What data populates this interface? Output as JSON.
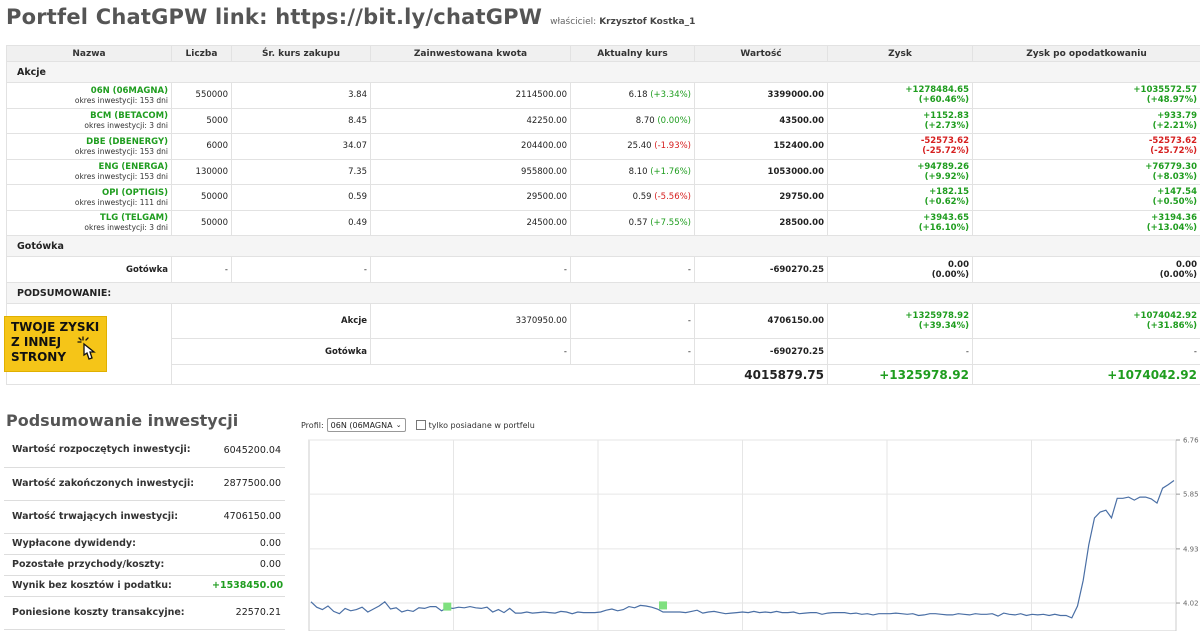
{
  "header": {
    "title": "Portfel ChatGPW link: https://bit.ly/chatGPW",
    "owner_label": "właściciel:",
    "owner_name": "Krzysztof Kostka_1"
  },
  "table": {
    "columns": [
      "Nazwa",
      "Liczba",
      "Śr. kurs zakupu",
      "Zainwestowana kwota",
      "Aktualny kurs",
      "Wartość",
      "Zysk",
      "Zysk po opodatkowaniu"
    ],
    "section_stocks": "Akcje",
    "stocks": [
      {
        "ticker": "06N (06MAGNA)",
        "period": "okres inwestycji: 153 dni",
        "count": "550000",
        "avg": "3.84",
        "invested": "2114500.00",
        "price": "6.18",
        "change": "(+3.34%)",
        "change_sign": "pos",
        "value": "3399000.00",
        "profit": "+1278484.65",
        "profit_pct": "(+60.46%)",
        "profit_sign": "pos",
        "net": "+1035572.57",
        "net_pct": "(+48.97%)"
      },
      {
        "ticker": "BCM (BETACOM)",
        "period": "okres inwestycji: 3 dni",
        "count": "5000",
        "avg": "8.45",
        "invested": "42250.00",
        "price": "8.70",
        "change": "(0.00%)",
        "change_sign": "pos",
        "value": "43500.00",
        "profit": "+1152.83",
        "profit_pct": "(+2.73%)",
        "profit_sign": "pos",
        "net": "+933.79",
        "net_pct": "(+2.21%)"
      },
      {
        "ticker": "DBE (DBENERGY)",
        "period": "okres inwestycji: 153 dni",
        "count": "6000",
        "avg": "34.07",
        "invested": "204400.00",
        "price": "25.40",
        "change": "(-1.93%)",
        "change_sign": "neg",
        "value": "152400.00",
        "profit": "-52573.62",
        "profit_pct": "(-25.72%)",
        "profit_sign": "neg",
        "net": "-52573.62",
        "net_pct": "(-25.72%)"
      },
      {
        "ticker": "ENG (ENERGA)",
        "period": "okres inwestycji: 153 dni",
        "count": "130000",
        "avg": "7.35",
        "invested": "955800.00",
        "price": "8.10",
        "change": "(+1.76%)",
        "change_sign": "pos",
        "value": "1053000.00",
        "profit": "+94789.26",
        "profit_pct": "(+9.92%)",
        "profit_sign": "pos",
        "net": "+76779.30",
        "net_pct": "(+8.03%)"
      },
      {
        "ticker": "OPI (OPTIGIS)",
        "period": "okres inwestycji: 111 dni",
        "count": "50000",
        "avg": "0.59",
        "invested": "29500.00",
        "price": "0.59",
        "change": "(-5.56%)",
        "change_sign": "neg",
        "value": "29750.00",
        "profit": "+182.15",
        "profit_pct": "(+0.62%)",
        "profit_sign": "pos",
        "net": "+147.54",
        "net_pct": "(+0.50%)"
      },
      {
        "ticker": "TLG (TELGAM)",
        "period": "okres inwestycji: 3 dni",
        "count": "50000",
        "avg": "0.49",
        "invested": "24500.00",
        "price": "0.57",
        "change": "(+7.55%)",
        "change_sign": "pos",
        "value": "28500.00",
        "profit": "+3943.65",
        "profit_pct": "(+16.10%)",
        "profit_sign": "pos",
        "net": "+3194.36",
        "net_pct": "(+13.04%)"
      }
    ],
    "section_cash": "Gotówka",
    "cash": {
      "name": "Gotówka",
      "count": "-",
      "avg": "-",
      "invested": "-",
      "price": "-",
      "value": "-690270.25",
      "profit": "0.00",
      "profit_pct": "(0.00%)",
      "net": "0.00",
      "net_pct": "(0.00%)"
    },
    "section_summary": "PODSUMOWANIE:",
    "summary_stocks": {
      "label": "Akcje",
      "invested": "3370950.00",
      "price": "-",
      "value": "4706150.00",
      "profit": "+1325978.92",
      "profit_pct": "(+39.34%)",
      "net": "+1074042.92",
      "net_pct": "(+31.86%)"
    },
    "summary_cash": {
      "label": "Gotówka",
      "invested": "-",
      "price": "-",
      "value": "-690270.25",
      "profit": "-",
      "net": "-"
    },
    "totals": {
      "value": "4015879.75",
      "profit": "+1325978.92",
      "net": "+1074042.92"
    }
  },
  "promo": {
    "line1": "TWOJE ZYSKI",
    "line2": "Z INNEJ",
    "line3": "STRONY",
    "icon": "pointer-hand-icon",
    "bg": "#f5c518"
  },
  "investments": {
    "title": "Podsumowanie inwestycji",
    "rows": [
      {
        "label": "Wartość rozpoczętych inwestycji:",
        "value": "6045200.04"
      },
      {
        "label": "Wartość zakończonych inwestycji:",
        "value": "2877500.00"
      },
      {
        "label": "Wartość trwających inwestycji:",
        "value": "4706150.00"
      },
      {
        "label": "Wypłacone dywidendy:",
        "value": "0.00"
      },
      {
        "label": "Pozostałe przychody/koszty:",
        "value": "0.00"
      },
      {
        "label": "Wynik bez kosztów i podatku:",
        "value": "+1538450.00"
      },
      {
        "label": "Poniesione koszty transakcyjne:",
        "value": "22570.21"
      }
    ]
  },
  "chart_controls": {
    "profile_label": "Profil:",
    "profile_value": "06N (06MAGNA",
    "checkbox_label": "tylko posiadane w portfelu",
    "checkbox_checked": false
  },
  "chart_data": {
    "type": "line",
    "title": "",
    "xlabel": "",
    "ylabel": "",
    "y_ticks": [
      4.02,
      4.93,
      5.85,
      6.76
    ],
    "ylim": [
      3.55,
      6.76
    ],
    "grid": true,
    "series": [
      {
        "color": "#4a6fa5",
        "values": [
          4.04,
          3.95,
          3.91,
          3.97,
          3.88,
          3.84,
          3.93,
          3.89,
          3.91,
          3.95,
          3.87,
          3.92,
          3.97,
          4.04,
          3.92,
          3.94,
          3.87,
          3.9,
          3.88,
          3.94,
          3.93,
          3.96,
          3.96,
          3.89,
          3.94,
          3.93,
          3.95,
          3.94,
          3.96,
          3.94,
          3.93,
          3.95,
          3.87,
          3.91,
          3.86,
          3.93,
          3.85,
          3.85,
          3.87,
          3.85,
          3.86,
          3.87,
          3.86,
          3.85,
          3.88,
          3.87,
          3.84,
          3.87,
          3.86,
          3.86,
          3.86,
          3.87,
          3.9,
          3.92,
          3.89,
          3.91,
          3.96,
          3.94,
          3.98,
          3.97,
          3.95,
          3.92,
          3.87,
          3.87,
          3.87,
          3.87,
          3.86,
          3.88,
          3.9,
          3.85,
          3.87,
          3.88,
          3.86,
          3.84,
          3.85,
          3.86,
          3.87,
          3.86,
          3.88,
          3.86,
          3.87,
          3.86,
          3.88,
          3.86,
          3.86,
          3.87,
          3.84,
          3.85,
          3.86,
          3.86,
          3.83,
          3.85,
          3.86,
          3.86,
          3.86,
          3.84,
          3.85,
          3.83,
          3.84,
          3.82,
          3.84,
          3.84,
          3.84,
          3.85,
          3.84,
          3.83,
          3.84,
          3.81,
          3.82,
          3.84,
          3.84,
          3.83,
          3.82,
          3.82,
          3.84,
          3.83,
          3.82,
          3.84,
          3.83,
          3.83,
          3.84,
          3.8,
          3.85,
          3.83,
          3.82,
          3.84,
          3.81,
          3.83,
          3.82,
          3.83,
          3.81,
          3.83,
          3.81,
          3.81,
          3.77,
          3.97,
          4.4,
          5.0,
          5.45,
          5.55,
          5.58,
          5.45,
          5.78,
          5.78,
          5.8,
          5.75,
          5.8,
          5.8,
          5.77,
          5.7,
          5.95,
          6.01,
          6.08
        ]
      }
    ],
    "markers": [
      {
        "index": 24,
        "value": 3.96,
        "color": "#7fe07f"
      },
      {
        "index": 62,
        "value": 3.98,
        "color": "#7fe07f"
      }
    ]
  }
}
